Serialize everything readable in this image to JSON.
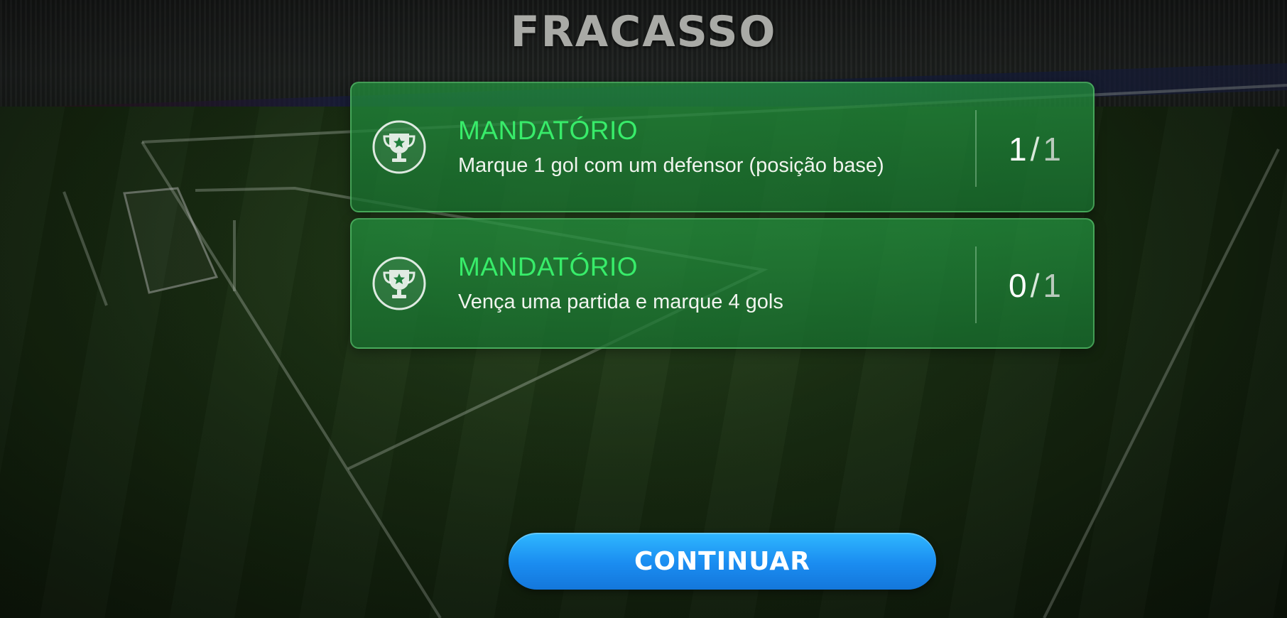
{
  "screen": {
    "title": "FRACASSO"
  },
  "missions": [
    {
      "icon": "trophy-icon",
      "label": "MANDATÓRIO",
      "description": "Marque 1 gol com um defensor (posição base)",
      "current": "1",
      "separator": "/",
      "total": "1"
    },
    {
      "icon": "trophy-icon",
      "label": "MANDATÓRIO",
      "description": "Vença uma partida e marque 4 gols",
      "current": "0",
      "separator": "/",
      "total": "1"
    }
  ],
  "actions": {
    "continue_label": "CONTINUAR"
  },
  "colors": {
    "card_green": "#228c3c",
    "label_green": "#38ec6a",
    "button_blue": "#1a8cf0",
    "title_grey": "#a9aaa6"
  }
}
